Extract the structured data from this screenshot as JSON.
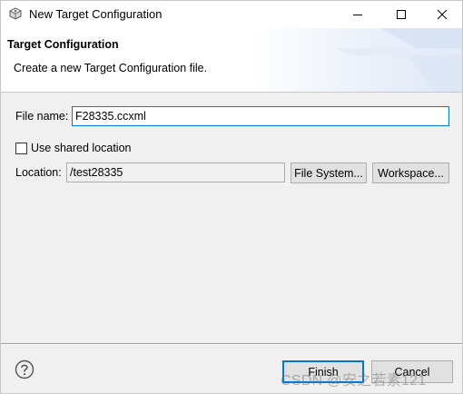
{
  "window": {
    "title": "New Target Configuration",
    "icon": "gear-cube-icon",
    "controls": [
      "minimize-icon",
      "maximize-icon",
      "close-icon"
    ]
  },
  "header": {
    "title": "Target Configuration",
    "description": "Create a new Target Configuration file."
  },
  "form": {
    "file_name_label": "File name:",
    "file_name_value": "F28335.ccxml",
    "use_shared_label": "Use shared location",
    "use_shared_checked": false,
    "location_label": "Location:",
    "location_value": "/test28335",
    "file_system_button": "File System...",
    "workspace_button": "Workspace..."
  },
  "footer": {
    "help_icon": "question-circle-icon",
    "finish_button": "Finish",
    "cancel_button": "Cancel"
  },
  "watermark": "CSDN @安之若素121",
  "colors": {
    "focus_border": "#0078d7",
    "dialog_background": "#f0f0f0",
    "button_face": "#e1e1e1"
  }
}
